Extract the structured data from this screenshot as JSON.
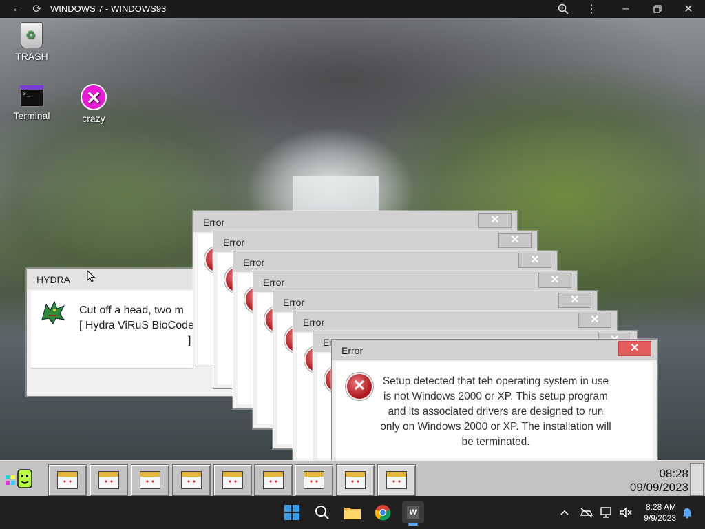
{
  "browser": {
    "title": "WINDOWS 7 - WINDOWS93",
    "icons": [
      "back-arrow-icon",
      "reload-icon",
      "zoom-icon",
      "more-icon",
      "minimize-icon",
      "restore-icon",
      "close-icon"
    ]
  },
  "desktop": {
    "icons": [
      {
        "label": "TRASH",
        "icon": "trash-icon"
      },
      {
        "label": "Terminal",
        "icon": "terminal-icon"
      },
      {
        "label": "crazy",
        "icon": "crazy-icon"
      }
    ]
  },
  "hydra": {
    "title": "HYDRA",
    "line1": "Cut off a head, two m",
    "line2": "[ Hydra ViRuS BioCode",
    "line3": "]"
  },
  "error_stack": {
    "title": "Error",
    "close": "✕",
    "count": 8
  },
  "error_front": {
    "title": "Error",
    "close": "✕",
    "message": "Setup detected that teh operating system in use is not Windows 2000 or XP. This setup program and its associated drivers are designed to run only on Windows 2000 or XP. The installation will be terminated."
  },
  "taskbar93": {
    "time": "08:28",
    "date": "09/09/2023",
    "buttons": 9
  },
  "taskbar11": {
    "app_label": "W",
    "time": "8:28 AM",
    "date": "9/9/2023"
  },
  "colors": {
    "error_close_active": "#e35a5a",
    "win_blue": "#3a9be6"
  }
}
